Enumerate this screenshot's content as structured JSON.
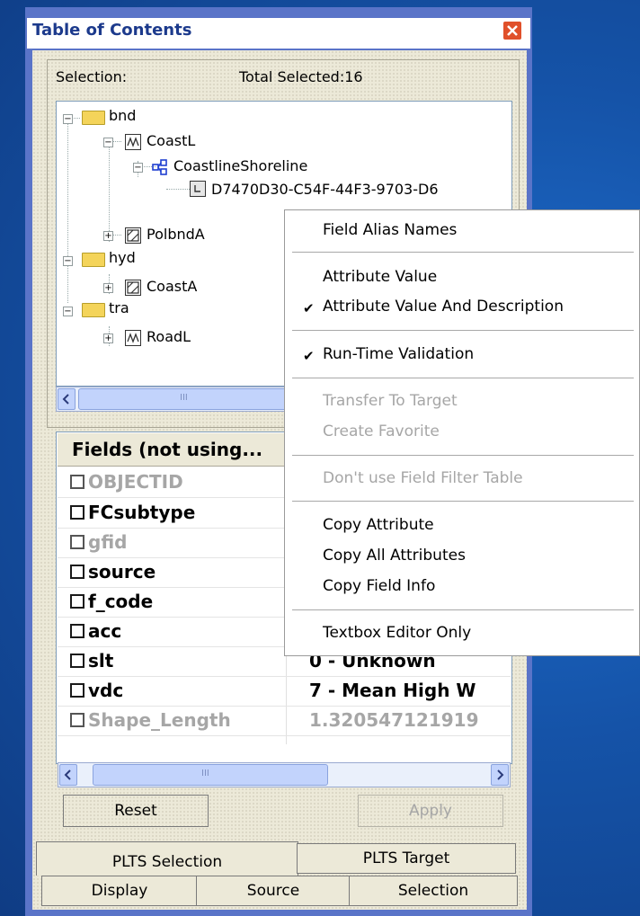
{
  "window": {
    "title": "Table of Contents"
  },
  "selection": {
    "label": "Selection:",
    "total": "Total Selected:16"
  },
  "tree": {
    "nodes": [
      "bnd",
      "CoastL",
      "CoastlineShoreline",
      "D7470D30-C54F-44F3-9703-D6",
      "PolbndA",
      "hyd",
      "CoastA",
      "tra",
      "RoadL"
    ],
    "scroll_grip": "III"
  },
  "fields": {
    "header": "Fields (not using...",
    "rows": [
      {
        "name": "OBJECTID",
        "value": ""
      },
      {
        "name": "FCsubtype",
        "value": ""
      },
      {
        "name": "gfid",
        "value": ""
      },
      {
        "name": "source",
        "value": ""
      },
      {
        "name": "f_code",
        "value": ""
      },
      {
        "name": "acc",
        "value": ""
      },
      {
        "name": "slt",
        "value": "0 - Unknown"
      },
      {
        "name": "vdc",
        "value": "7 - Mean High W"
      },
      {
        "name": "Shape_Length",
        "value": "1.320547121919"
      }
    ],
    "scroll_grip": "III"
  },
  "buttons": {
    "reset": "Reset",
    "apply": "Apply"
  },
  "tabs": {
    "top": [
      "PLTS Selection",
      "PLTS Target"
    ],
    "bottom": [
      "Display",
      "Source",
      "Selection"
    ]
  },
  "context_menu": {
    "items": [
      "Field Alias Names",
      "Attribute Value",
      "Attribute Value And Description",
      "Run-Time Validation",
      "Transfer To Target",
      "Create Favorite",
      "Don't use Field Filter Table",
      "Copy Attribute",
      "Copy All Attributes",
      "Copy Field Info",
      "Textbox Editor Only"
    ],
    "checked": [
      "Attribute Value And Description",
      "Run-Time Validation"
    ],
    "disabled": [
      "Transfer To Target",
      "Create Favorite",
      "Don't use Field Filter Table"
    ],
    "check_glyph": "✔"
  },
  "icons": [
    "close-icon",
    "folder-icon",
    "line-feature-icon",
    "polygon-feature-icon",
    "topology-icon",
    "record-icon",
    "chevron-left-icon",
    "chevron-right-icon"
  ],
  "colors": {
    "title_text": "#1c3a8c",
    "close_button": "#e0502a",
    "panel": "#ece9d8",
    "disabled_text": "#a6a6a6"
  }
}
